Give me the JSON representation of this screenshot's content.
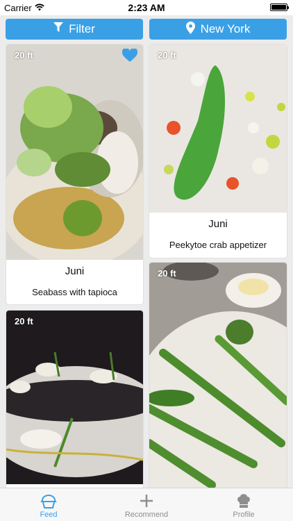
{
  "status": {
    "carrier": "Carrier",
    "time": "2:23 AM"
  },
  "toolbar": {
    "filter_label": "Filter",
    "location_label": "New York"
  },
  "feed": {
    "items": [
      {
        "distance": "20 ft",
        "user": "Juni",
        "dish": "Seabass with tapioca",
        "liked": true
      },
      {
        "distance": "20 ft",
        "user": "Juni",
        "dish": "Peekytoe crab appetizer",
        "liked": false
      },
      {
        "distance": "20 ft",
        "user": "",
        "dish": "",
        "liked": false
      },
      {
        "distance": "20 ft",
        "user": "",
        "dish": "",
        "liked": false
      }
    ]
  },
  "tabs": [
    {
      "label": "Feed",
      "active": true
    },
    {
      "label": "Recommend",
      "active": false
    },
    {
      "label": "Profile",
      "active": false
    }
  ],
  "colors": {
    "accent": "#3aa0e6",
    "background": "#ececec"
  }
}
